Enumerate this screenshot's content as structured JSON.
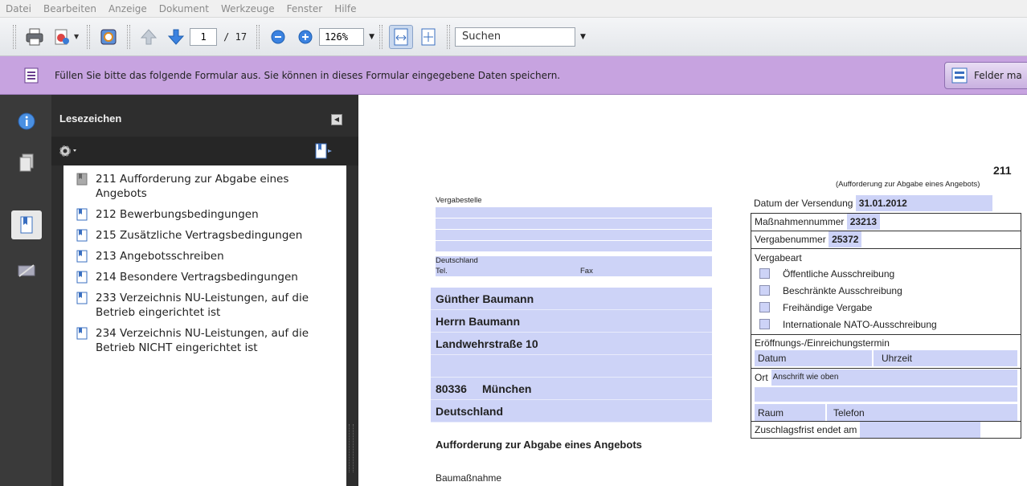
{
  "menu": [
    "Datei",
    "Bearbeiten",
    "Anzeige",
    "Dokument",
    "Werkzeuge",
    "Fenster",
    "Hilfe"
  ],
  "toolbar": {
    "page_current": "1",
    "page_total": "/ 17",
    "zoom": "126%",
    "search_placeholder": "Suchen"
  },
  "formbar": {
    "message": "Füllen Sie bitte das folgende Formular aus. Sie können in dieses Formular eingegebene Daten speichern.",
    "button_label": "Felder ma"
  },
  "bookmarks": {
    "title": "Lesezeichen",
    "items": [
      {
        "label": "211 Aufforderung zur Abgabe eines Angebots"
      },
      {
        "label": "212 Bewerbungsbedingungen"
      },
      {
        "label": "215 Zusätzliche Vertragsbedingungen"
      },
      {
        "label": "213 Angebotsschreiben"
      },
      {
        "label": "214 Besondere Vertragsbedingungen"
      },
      {
        "label": "233 Verzeichnis NU-Leistungen, auf die Betrieb eingerichtet ist"
      },
      {
        "label": "234 Verzeichnis NU-Leistungen, auf die Betrieb NICHT eingerichtet ist"
      }
    ]
  },
  "document": {
    "form_number": "211",
    "form_subtitle": "(Aufforderung zur Abgabe eines Angebots)",
    "vergabestelle_label": "Vergabestelle",
    "vergabestelle_country": "Deutschland",
    "tel_label": "Tel.",
    "fax_label": "Fax",
    "recipient": {
      "name": "Günther Baumann",
      "salutation": "Herrn Baumann",
      "street": "Landwehrstraße 10",
      "line4": "",
      "plz": "80336",
      "city": "München",
      "country": "Deutschland"
    },
    "heading": "Aufforderung zur Abgabe eines Angebots",
    "baumassnahme_label": "Baumaßnahme",
    "right_form": {
      "versendung_label": "Datum der Versendung",
      "versendung_value": "31.01.2012",
      "massnahme_label": "Maßnahmennummer",
      "massnahme_value": "23213",
      "vergabenummer_label": "Vergabenummer",
      "vergabenummer_value": "25372",
      "vergabeart_label": "Vergabeart",
      "vergabeart_options": [
        "Öffentliche Ausschreibung",
        "Beschränkte Ausschreibung",
        "Freihändige Vergabe",
        "Internationale NATO-Ausschreibung"
      ],
      "eroeffnung_label": "Eröffnungs-/Einreichungstermin",
      "datum_label": "Datum",
      "uhrzeit_label": "Uhrzeit",
      "ort_label": "Ort",
      "ort_value": "Anschrift wie oben",
      "raum_label": "Raum",
      "telefon_label": "Telefon",
      "zuschlag_label": "Zuschlagsfrist endet am"
    }
  }
}
